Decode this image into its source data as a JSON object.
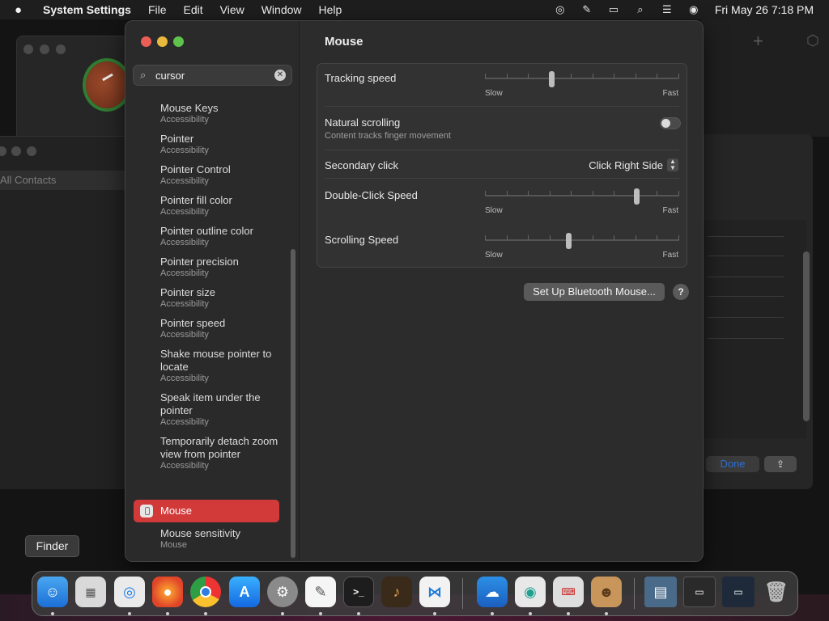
{
  "menubar": {
    "apple": "",
    "items": [
      "System Settings",
      "File",
      "Edit",
      "View",
      "Window",
      "Help"
    ],
    "clock": "Fri May 26  7:18 PM"
  },
  "background": {
    "contacts_label": "All Contacts",
    "done_label": "Done"
  },
  "sidebar": {
    "search_value": "cursor",
    "results": [
      {
        "title": "Mouse Keys",
        "sub": "Accessibility"
      },
      {
        "title": "Pointer",
        "sub": "Accessibility"
      },
      {
        "title": "Pointer Control",
        "sub": "Accessibility"
      },
      {
        "title": "Pointer fill color",
        "sub": "Accessibility"
      },
      {
        "title": "Pointer outline color",
        "sub": "Accessibility"
      },
      {
        "title": "Pointer precision",
        "sub": "Accessibility"
      },
      {
        "title": "Pointer size",
        "sub": "Accessibility"
      },
      {
        "title": "Pointer speed",
        "sub": "Accessibility"
      },
      {
        "title": "Shake mouse pointer to locate",
        "sub": "Accessibility"
      },
      {
        "title": "Speak item under the pointer",
        "sub": "Accessibility"
      },
      {
        "title": "Temporarily detach zoom view from pointer",
        "sub": "Accessibility"
      }
    ],
    "selected": {
      "label": "Mouse"
    },
    "after_selected": {
      "title": "Mouse sensitivity",
      "sub": "Mouse"
    }
  },
  "content": {
    "title": "Mouse",
    "tracking_speed": {
      "label": "Tracking speed",
      "slow": "Slow",
      "fast": "Fast",
      "level": 0.34
    },
    "natural_scrolling": {
      "label": "Natural scrolling",
      "sub": "Content tracks finger movement",
      "on": false
    },
    "secondary_click": {
      "label": "Secondary click",
      "value": "Click Right Side"
    },
    "double_click": {
      "label": "Double-Click Speed",
      "slow": "Slow",
      "fast": "Fast",
      "level": 0.79
    },
    "scrolling_speed": {
      "label": "Scrolling Speed",
      "slow": "Slow",
      "fast": "Fast",
      "level": 0.43
    },
    "bt_button": "Set Up Bluetooth Mouse...",
    "help": "?"
  },
  "tooltip": "Finder",
  "dock": {
    "apps": [
      "finder-icon",
      "launchpad-icon",
      "safari-icon",
      "firefox-icon",
      "chrome-icon",
      "app-store-icon",
      "system-settings-icon",
      "textedit-icon",
      "terminal-icon",
      "garageband-icon",
      "vscode-icon",
      "weather-icon",
      "app-icon",
      "keyboard-app-icon",
      "contacts-icon",
      "downloads-stack-icon",
      "recent-stack-icon",
      "recent-stack2-icon",
      "trash-icon"
    ]
  }
}
